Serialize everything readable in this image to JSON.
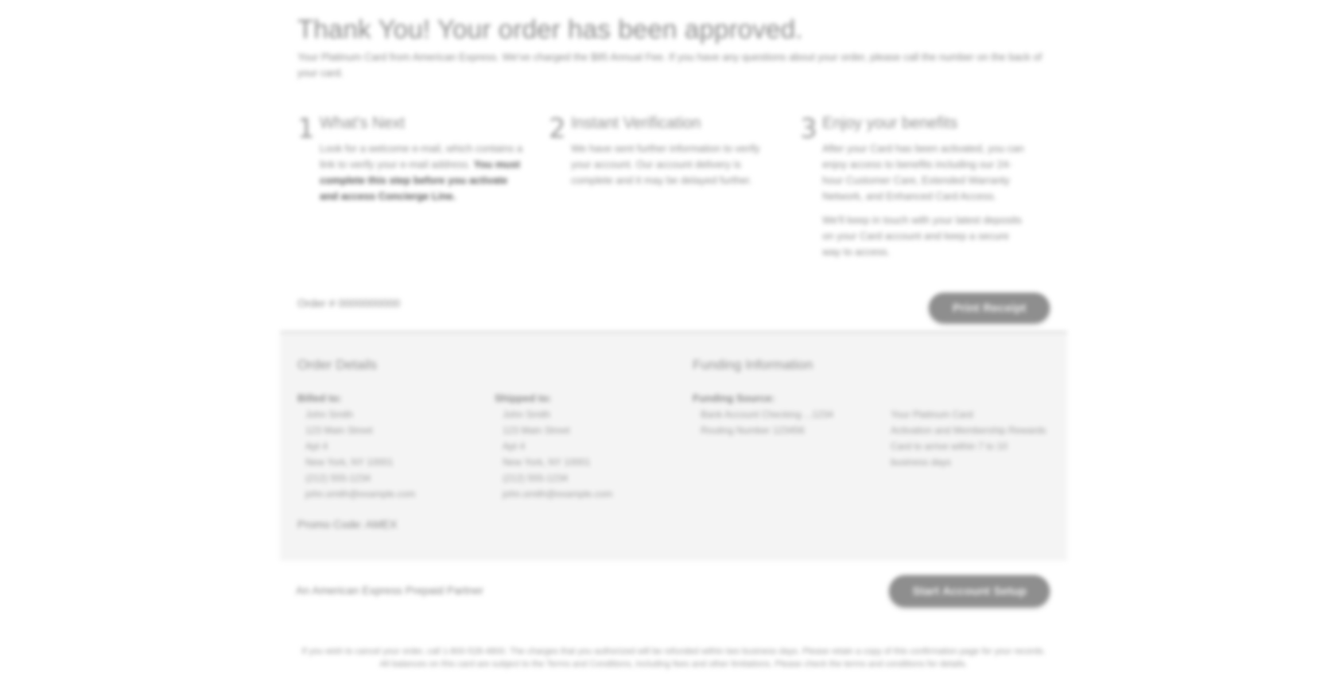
{
  "header": {
    "title": "Thank You! Your order has been approved.",
    "subtitle": "Your Platinum Card from American Express. We've charged the $95 Annual Fee. If you have any questions about your order, please call the number on the back of your card."
  },
  "steps": [
    {
      "number": "1",
      "title": "What's Next",
      "text": "Look for a welcome e-mail, which contains a link to verify your e-mail address.",
      "strong": "You must complete this step before you activate and access Concierge Line."
    },
    {
      "number": "2",
      "title": "Instant Verification",
      "text": "We have sent further information to verify your account. Our account delivery is complete and it may be delayed further."
    },
    {
      "number": "3",
      "title": "Enjoy your benefits",
      "text": "After your Card has been activated, you can enjoy access to benefits including our 24-hour Customer Care, Extended Warranty Network, and Enhanced Card Access.",
      "text2": "We'll keep in touch with your latest deposits on your Card account and keep a secure way to access."
    }
  ],
  "order": {
    "line": "Order # 0000000000",
    "print_label": "Print Receipt"
  },
  "details": {
    "order_title": "Order Details",
    "shipping_title": "Funding Information",
    "billed_to": {
      "label": "Billed to:",
      "lines": [
        "John Smith",
        "123 Main Street",
        "Apt 4",
        "New York, NY 10001",
        "(212) 555-1234",
        "john.smith@example.com"
      ]
    },
    "shipped_to": {
      "label": "Shipped to:",
      "lines": [
        "John Smith",
        "123 Main Street",
        "Apt 4",
        "New York, NY 10001",
        "(212) 555-1234",
        "john.smith@example.com"
      ]
    },
    "funding": {
      "label": "Funding Source:",
      "lines": [
        "Bank Account Checking ...1234",
        "Routing Number 123456"
      ]
    },
    "notes": {
      "lines": [
        "Your Platinum Card",
        "Activation and Membership Rewards",
        "Card to arrive within 7 to 10",
        "business days"
      ]
    },
    "promo": "Promo Code: AMEX"
  },
  "footer": {
    "link_text": "An American Express Prepaid Partner",
    "activate_label": "Start Account Setup",
    "disclaimer": "If you wish to cancel your order, call 1-800-528-4800. The charges that you authorized will be refunded within two business days. Please retain a copy of this confirmation page for your records. All balances on this card are subject to the Terms and Conditions, including fees and other limitations. Please check the terms and conditions for details."
  }
}
